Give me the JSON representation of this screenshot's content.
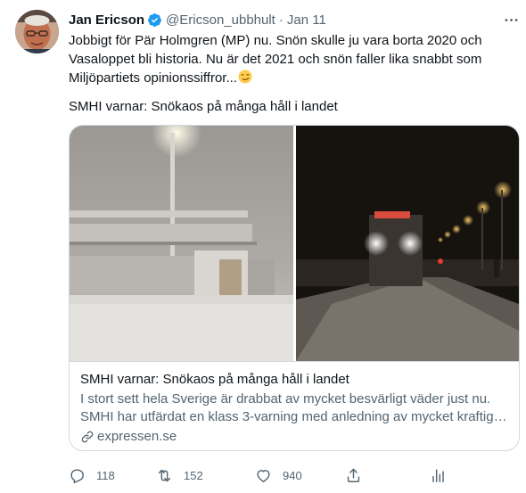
{
  "tweet": {
    "author_name": "Jan Ericson",
    "author_handle": "@Ericson_ubbhult",
    "separator": "·",
    "date": "Jan 11",
    "text": "Jobbigt för Pär Holmgren (MP) nu. Snön skulle ju vara borta 2020 och\nVasaloppet bli historia. Nu är det 2021 och snön faller lika snabbt som\nMiljöpartiets opinionssiffror...",
    "text_line2": "SMHI varnar: Snökaos på många håll i landet",
    "emoji": "smirking-face"
  },
  "card": {
    "title": "SMHI varnar: Snökaos på många håll i landet",
    "description_line1": "I stort sett hela Sverige är drabbat av mycket besvärligt väder just nu.",
    "description_line2": "SMHI har utfärdat en klass 3-varning med anledning av mycket kraftigt...",
    "domain": "expressen.se"
  },
  "actions": {
    "replies": "118",
    "retweets": "152",
    "likes": "940"
  },
  "icons": {
    "verified": "verified-badge-icon",
    "more": "more-icon",
    "link": "link-icon",
    "reply": "reply-icon",
    "retweet": "retweet-icon",
    "like": "heart-icon",
    "share": "share-icon",
    "analytics": "analytics-icon"
  },
  "colors": {
    "accent": "#1d9bf0",
    "secondary_text": "#536471",
    "border": "#cfd9de"
  }
}
